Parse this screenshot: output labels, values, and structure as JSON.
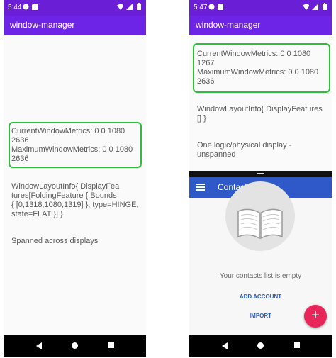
{
  "colors": {
    "app_bar": "#6d24e6",
    "status_bar": "#6a1fd6",
    "highlight": "#2dbf3a",
    "contacts_bar": "#2f59c8",
    "fab": "#e8265a",
    "link": "#2b5fc7"
  },
  "left_phone": {
    "status_time": "5:44",
    "app_title": "window-manager",
    "metrics_line1": "CurrentWindowMetrics: 0 0 1080",
    "metrics_line2": "2636",
    "metrics_line3": "MaximumWindowMetrics: 0 0 1080",
    "metrics_line4": "2636",
    "layout_line1": "WindowLayoutInfo{ DisplayFea",
    "layout_line2": "tures[FoldingFeature { Bounds",
    "layout_line3": "{ [0,1318,1080,1319] }, type=HINGE,",
    "layout_line4": "state=FLAT }] }",
    "display_text": "Spanned across displays"
  },
  "right_phone": {
    "status_time": "5:47",
    "app_title": "window-manager",
    "metrics_line1": "CurrentWindowMetrics: 0 0 1080",
    "metrics_line2": "1267",
    "metrics_line3": "MaximumWindowMetrics: 0 0 1080",
    "metrics_line4": "2636",
    "layout_line1": "WindowLayoutInfo{ DisplayFeatures",
    "layout_line2": "[] }",
    "display_line1": "One logic/physical display -",
    "display_line2": "unspanned",
    "contacts_title": "Contacts",
    "empty_text": "Your contacts list is empty",
    "add_account": "ADD ACCOUNT",
    "import": "IMPORT",
    "fab_label": "+"
  },
  "icons": {
    "menu": "menu-icon",
    "book": "book-icon",
    "add": "add-icon",
    "back": "back-icon",
    "home": "home-icon",
    "recents": "recents-icon",
    "wifi": "wifi-icon",
    "signal": "signal-icon",
    "battery": "battery-icon"
  }
}
